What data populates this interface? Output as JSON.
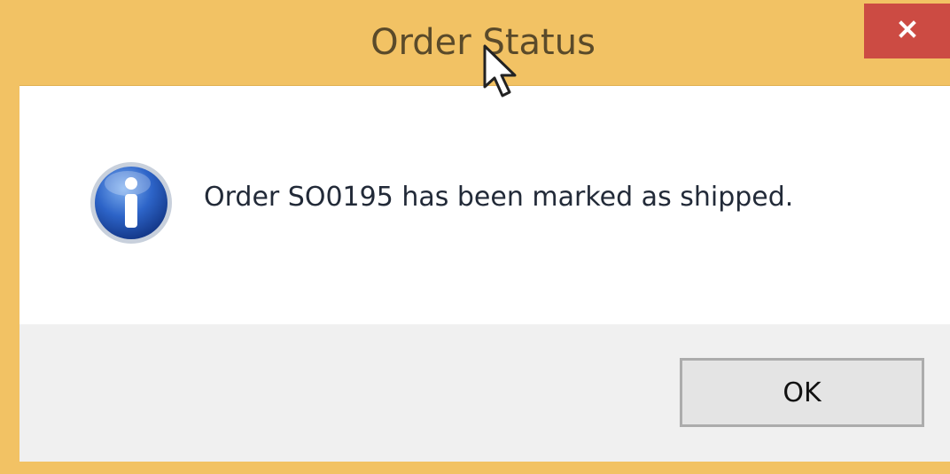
{
  "window": {
    "title": "Order Status",
    "close_icon": "close-icon"
  },
  "content": {
    "icon": "info-icon",
    "message": "Order SO0195 has been marked as shipped."
  },
  "buttons": {
    "ok_label": "OK"
  },
  "colors": {
    "titlebar": "#f2c264",
    "close_button": "#cc4b43",
    "content_bg": "#ffffff",
    "button_area_bg": "#f0f0f0"
  }
}
